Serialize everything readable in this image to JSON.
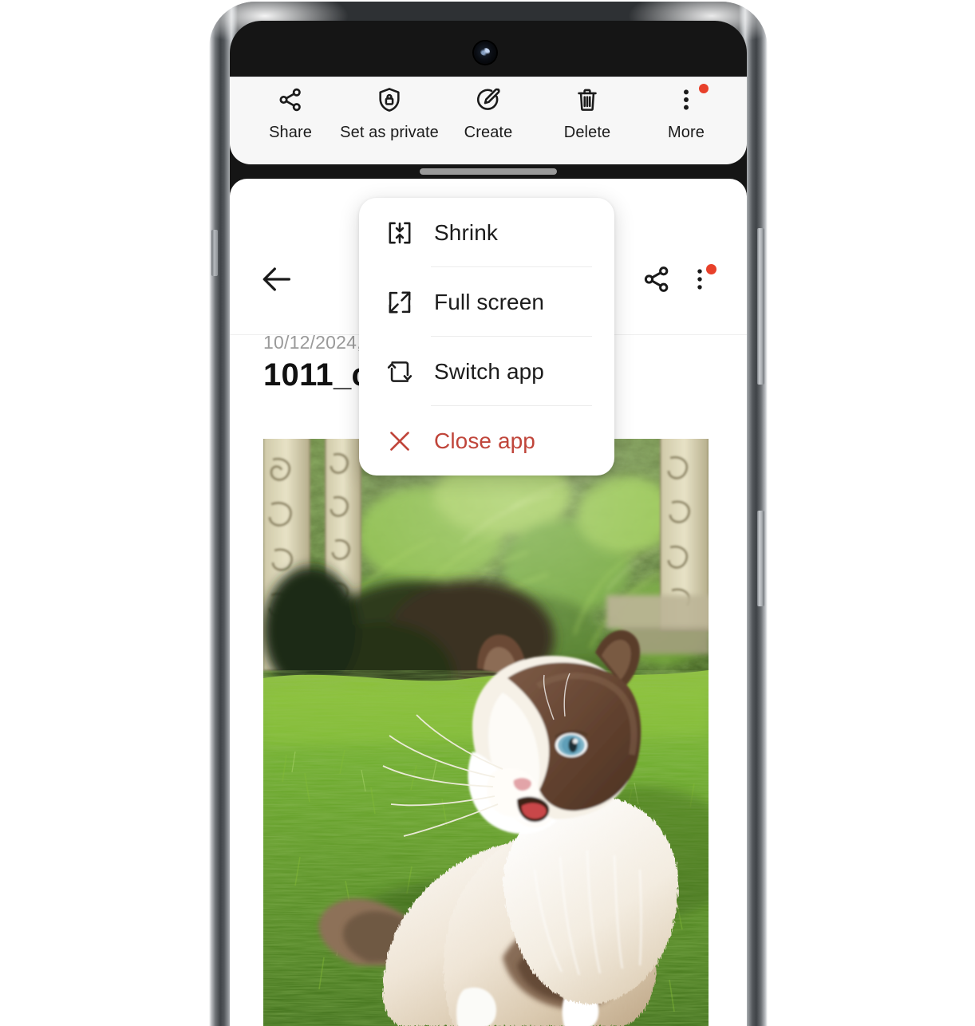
{
  "device": {
    "type": "smartphone",
    "camera_icon": "front-camera-punch-hole",
    "frame_color": "#2e3134"
  },
  "floating_toolbar": {
    "items": [
      {
        "label": "Share",
        "icon": "share-icon",
        "badge": false
      },
      {
        "label": "Set as private",
        "icon": "shield-lock-icon",
        "badge": false
      },
      {
        "label": "Create",
        "icon": "edit-circle-icon",
        "badge": false
      },
      {
        "label": "Delete",
        "icon": "trash-icon",
        "badge": false
      },
      {
        "label": "More",
        "icon": "more-vertical-icon",
        "badge": true
      }
    ],
    "badge_color": "#e8402a",
    "drag_handle": "window-drag-handle"
  },
  "app_window": {
    "header": {
      "back_icon": "arrow-left-icon",
      "share_icon": "share-icon",
      "more_icon": "more-vertical-icon",
      "more_badge": true
    },
    "photo_meta": {
      "date": "10/12/2024,",
      "filename": "1011_c"
    },
    "photo": {
      "alt": "Ragdoll cat sitting on green grass in a sunny garden with carved stone pillars and tropical plants"
    }
  },
  "popup_menu": {
    "items": [
      {
        "label": "Shrink",
        "icon": "shrink-icon",
        "danger": false
      },
      {
        "label": "Full screen",
        "icon": "fullscreen-icon",
        "danger": false
      },
      {
        "label": "Switch app",
        "icon": "switch-app-icon",
        "danger": false
      },
      {
        "label": "Close app",
        "icon": "close-x-icon",
        "danger": true
      }
    ],
    "danger_color": "#c0453a"
  }
}
